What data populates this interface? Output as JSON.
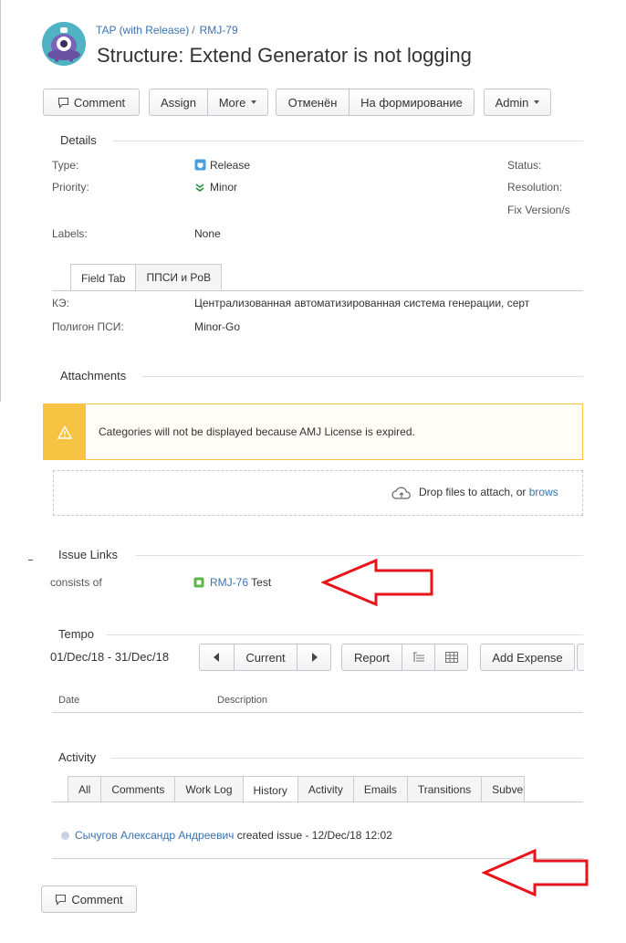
{
  "header": {
    "project": "TAP (with Release)",
    "separator": "/",
    "issue_key": "RMJ-79",
    "title": "Structure: Extend Generator is not logging"
  },
  "toolbar": {
    "comment": "Comment",
    "assign": "Assign",
    "more": "More",
    "cancelled": "Отменён",
    "to_form": "На формирование",
    "admin": "Admin"
  },
  "details": {
    "heading": "Details",
    "type_label": "Type:",
    "type_value": "Release",
    "priority_label": "Priority:",
    "priority_value": "Minor",
    "status_label": "Status:",
    "resolution_label": "Resolution:",
    "fixversion_label": "Fix Version/s",
    "labels_label": "Labels:",
    "labels_value": "None"
  },
  "field_tabs": {
    "tab1": "Field Tab",
    "tab2": "ППСИ и PoB"
  },
  "fields": {
    "ke_label": "КЭ:",
    "ke_value": "Централизованная автоматизированная система генерации, серт",
    "polygon_label": "Полигон ПСИ:",
    "polygon_value": "Minor-Go"
  },
  "attachments": {
    "heading": "Attachments",
    "warning": "Categories will not be displayed because AMJ License is expired.",
    "drop_text": "Drop files to attach, or ",
    "browse_link": "brows"
  },
  "issue_links": {
    "heading": "Issue Links",
    "relation": "consists of",
    "linked_key": "RMJ-76",
    "linked_summary": "Test"
  },
  "tempo": {
    "heading": "Tempo",
    "range": "01/Dec/18 - 31/Dec/18",
    "current": "Current",
    "report": "Report",
    "add_expense": "Add Expense",
    "col_date": "Date",
    "col_description": "Description"
  },
  "activity": {
    "heading": "Activity",
    "tabs": [
      "All",
      "Comments",
      "Work Log",
      "History",
      "Activity",
      "Emails",
      "Transitions",
      "Subvers"
    ],
    "user": "Сычугов Александр Андреевич",
    "action": " created issue - 12/Dec/18 12:02"
  },
  "footer": {
    "comment": "Comment"
  },
  "colors": {
    "link": "#3b73af",
    "warning": "#f6c342",
    "arrow": "#e8131b",
    "avatar": "#4fb3c4"
  }
}
